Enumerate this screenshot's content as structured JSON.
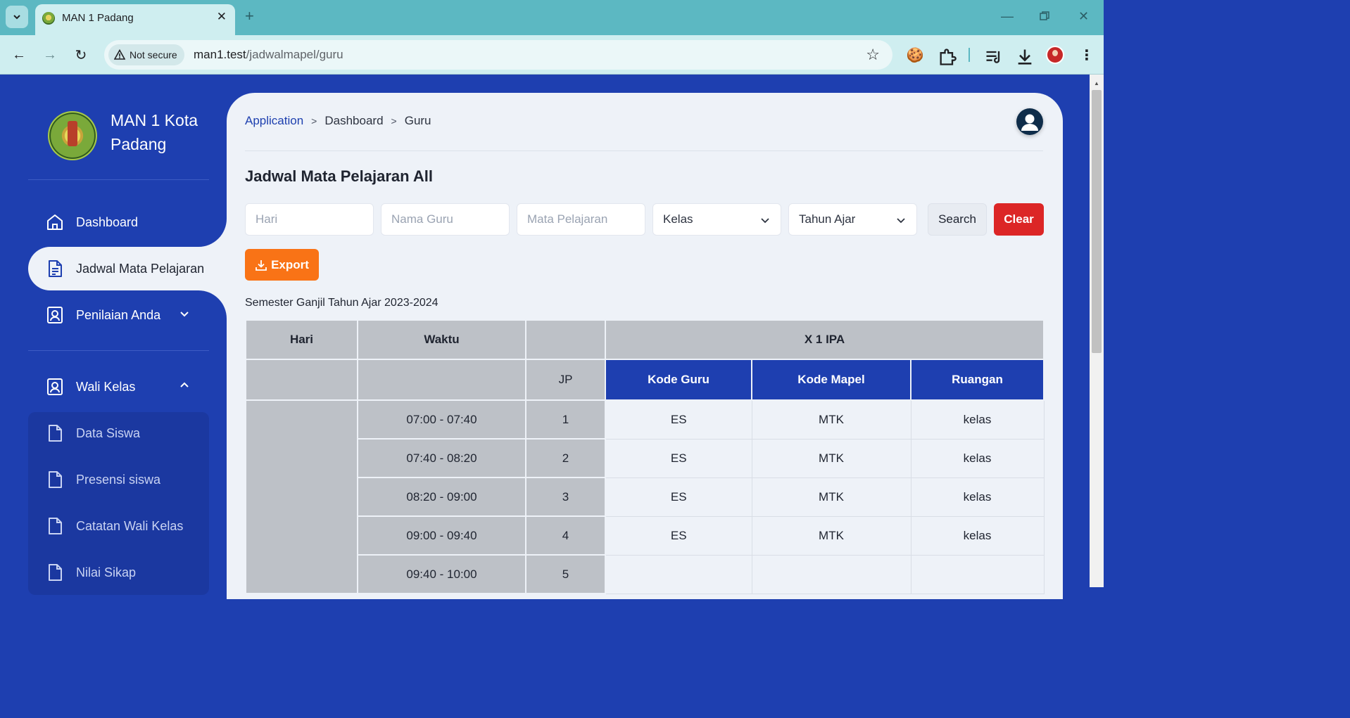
{
  "browser": {
    "tab_title": "MAN 1 Padang",
    "security_label": "Not secure",
    "url_host": "man1.test",
    "url_path": "/jadwalmapel/guru"
  },
  "sidebar": {
    "brand": "MAN 1 Kota Padang",
    "items": [
      {
        "label": "Dashboard",
        "icon": "home-icon"
      },
      {
        "label": "Jadwal Mata Pelajaran",
        "icon": "document-icon",
        "active": true
      },
      {
        "label": "Penilaian Anda",
        "icon": "user-square-icon",
        "expanded": false
      },
      {
        "label": "Wali Kelas",
        "icon": "user-square-icon",
        "expanded": true
      }
    ],
    "submenu": [
      {
        "label": "Data Siswa",
        "icon": "file-icon"
      },
      {
        "label": "Presensi siswa",
        "icon": "file-icon"
      },
      {
        "label": "Catatan Wali Kelas",
        "icon": "file-icon"
      },
      {
        "label": "Nilai Sikap",
        "icon": "file-icon"
      }
    ]
  },
  "breadcrumb": [
    "Application",
    "Dashboard",
    "Guru"
  ],
  "page_title": "Jadwal Mata Pelajaran All",
  "filters": {
    "hari_placeholder": "Hari",
    "guru_placeholder": "Nama Guru",
    "mapel_placeholder": "Mata Pelajaran",
    "kelas_value": "Kelas",
    "tahun_value": "Tahun Ajar",
    "search_label": "Search",
    "clear_label": "Clear"
  },
  "export_label": "Export",
  "semester_text": "Semester Ganjil Tahun Ajar 2023-2024",
  "table": {
    "headers": {
      "hari": "Hari",
      "waktu": "Waktu",
      "kelas": "X 1 IPA",
      "jp": "JP",
      "kode_guru": "Kode Guru",
      "kode_mapel": "Kode Mapel",
      "ruangan": "Ruangan"
    },
    "rows": [
      {
        "waktu": "07:00 - 07:40",
        "jp": "1",
        "kode_guru": "ES",
        "kode_mapel": "MTK",
        "ruangan": "kelas"
      },
      {
        "waktu": "07:40 - 08:20",
        "jp": "2",
        "kode_guru": "ES",
        "kode_mapel": "MTK",
        "ruangan": "kelas"
      },
      {
        "waktu": "08:20 - 09:00",
        "jp": "3",
        "kode_guru": "ES",
        "kode_mapel": "MTK",
        "ruangan": "kelas"
      },
      {
        "waktu": "09:00 - 09:40",
        "jp": "4",
        "kode_guru": "ES",
        "kode_mapel": "MTK",
        "ruangan": "kelas"
      },
      {
        "waktu": "09:40 - 10:00",
        "jp": "5",
        "kode_guru": "",
        "kode_mapel": "",
        "ruangan": ""
      }
    ]
  },
  "colors": {
    "primary": "#1e3fb0",
    "export": "#f97316",
    "clear": "#dc2626",
    "content_bg": "#eef2f8",
    "header_grey": "#bdc1c7"
  }
}
